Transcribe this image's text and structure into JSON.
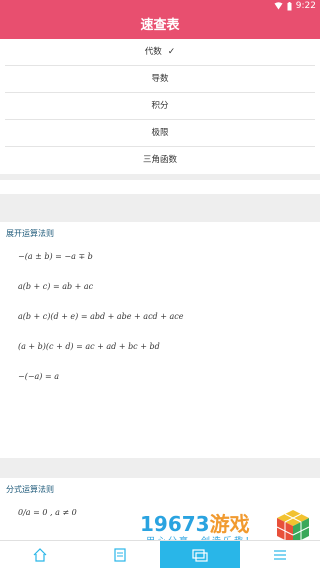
{
  "status_bar": {
    "time": "9:22"
  },
  "app_bar": {
    "title": "速查表"
  },
  "dropdown": {
    "items": [
      {
        "label": "代数",
        "selected": true
      },
      {
        "label": "导数"
      },
      {
        "label": "积分"
      },
      {
        "label": "极限"
      },
      {
        "label": "三角函数"
      }
    ]
  },
  "sections": [
    {
      "title": "展开运算法则",
      "formulas": [
        "−(a ± b) = −a ∓ b",
        "a(b + c) = ab + ac",
        "a(b + c)(d + e) = abd + abe + acd + ace",
        "(a + b)(c + d) = ac + ad + bc + bd",
        "−(−a) = a"
      ]
    },
    {
      "title": "分式运算法则",
      "formulas": [
        "0/a = 0 , a ≠ 0"
      ]
    }
  ],
  "watermark": {
    "brand_num": "19673",
    "brand_cn": "游戏",
    "slogan": "用心分享，创造乐趣！"
  },
  "colors": {
    "primary": "#e84f6f",
    "nav_active": "#29b6e8",
    "section_title": "#1e5a7a"
  }
}
